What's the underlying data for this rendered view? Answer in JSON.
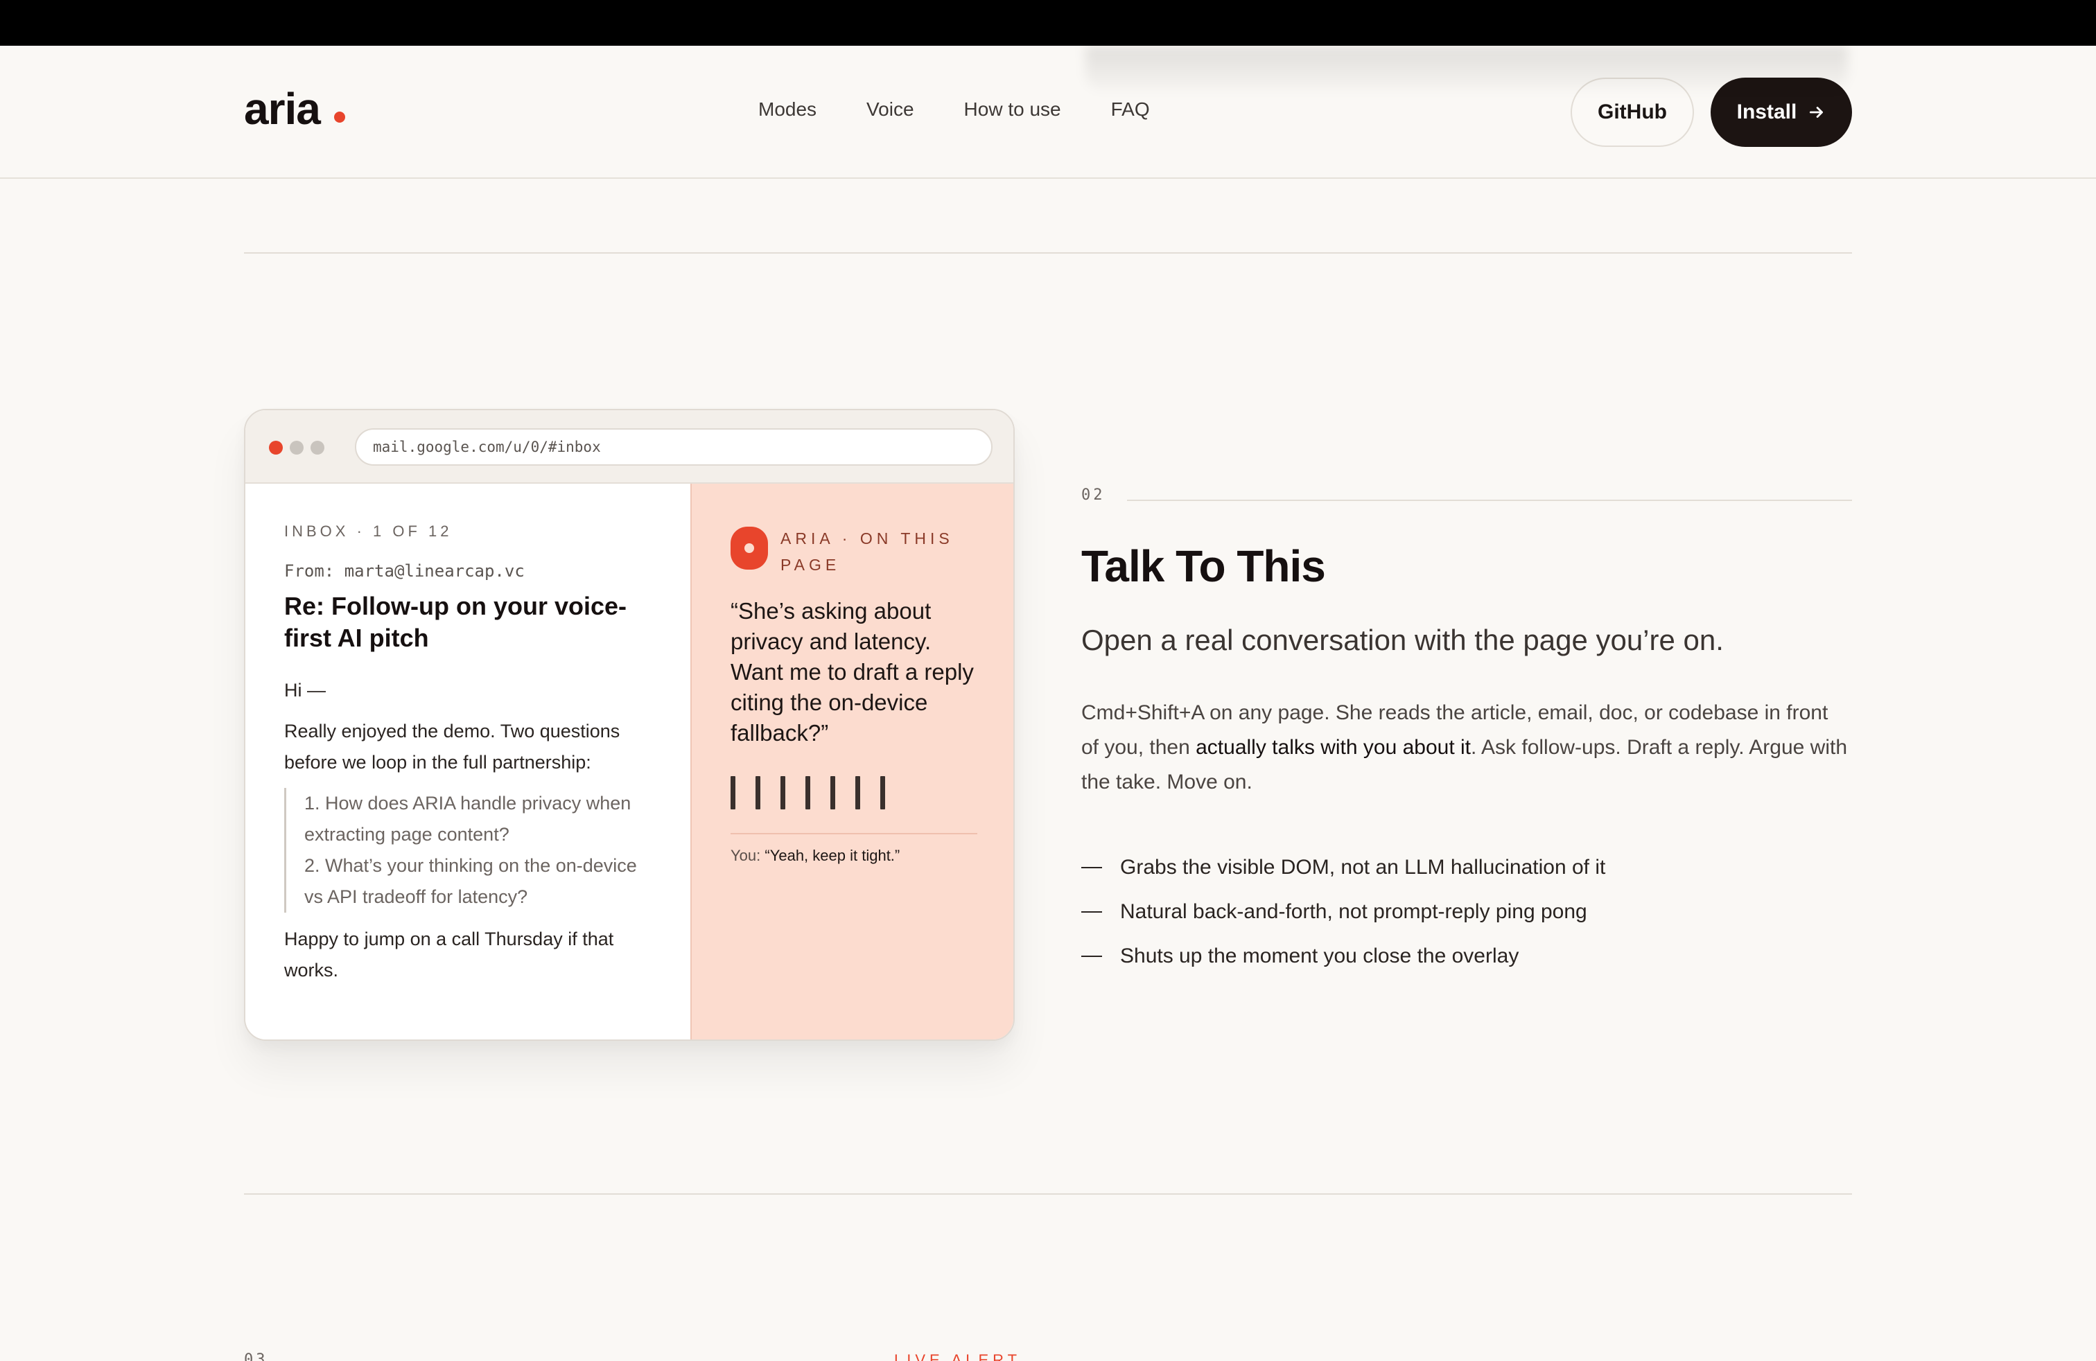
{
  "brand": {
    "name": "aria",
    "accent": "#e8452c"
  },
  "nav": {
    "links": [
      "Modes",
      "Voice",
      "How to use",
      "FAQ"
    ]
  },
  "actions": {
    "github": "GitHub",
    "install": "Install"
  },
  "browser": {
    "url": "mail.google.com/u/0/#inbox",
    "email": {
      "meta": "INBOX · 1 OF 12",
      "from": "From: marta@linearcap.vc",
      "subject": "Re: Follow-up on your voice-first AI pitch",
      "greeting": "Hi —",
      "intro": "Really enjoyed the demo. Two questions before we loop in the full partnership:",
      "q1": "1. How does ARIA handle privacy when extracting page content?",
      "q2": "2. What’s your thinking on the on-device vs API tradeoff for latency?",
      "closing": "Happy to jump on a call Thursday if that works."
    },
    "aria": {
      "label": "ARIA · ON THIS PAGE",
      "quote": "“She’s asking about privacy and latency. Want me to draft a reply citing the on-device fallback?”",
      "you_label": "You:",
      "you_text": "“Yeah, keep it tight.”"
    }
  },
  "section": {
    "number": "02",
    "title": "Talk To This",
    "subtitle": "Open a real conversation with the page you’re on.",
    "desc_pre": "Cmd+Shift+A on any page. She reads the article, email, doc, or codebase in front of you, then ",
    "desc_em": "actually talks with you about it",
    "desc_post": ". Ask follow-ups. Draft a reply. Argue with the take. Move on.",
    "bullets": [
      "Grabs the visible DOM, not an LLM hallucination of it",
      "Natural back-and-forth, not prompt-reply ping pong",
      "Shuts up the moment you close the overlay"
    ]
  },
  "next_section": {
    "number": "03",
    "tag": "LIVE ALERT"
  }
}
